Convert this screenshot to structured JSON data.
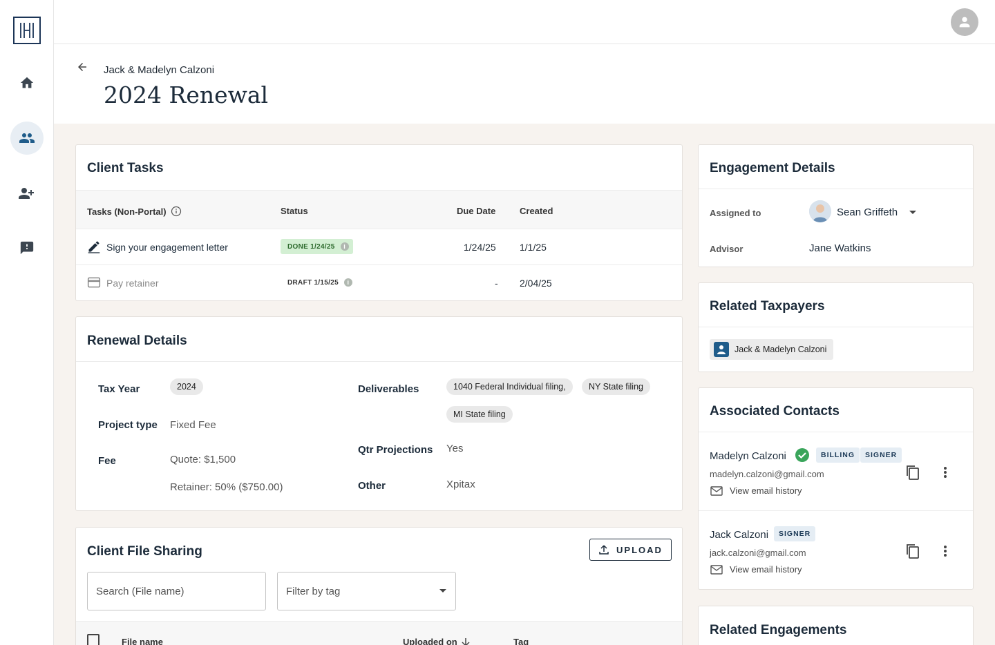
{
  "sidebar": {
    "logo_text": "H",
    "items": [
      {
        "icon": "home-icon"
      },
      {
        "icon": "people-icon",
        "active": true
      },
      {
        "icon": "person-add-icon"
      },
      {
        "icon": "feedback-icon"
      }
    ]
  },
  "header": {
    "breadcrumb": "Jack & Madelyn Calzoni",
    "title": "2024 Renewal"
  },
  "client_tasks": {
    "title": "Client Tasks",
    "columns": [
      "Tasks (Non-Portal)",
      "Status",
      "Due Date",
      "Created"
    ],
    "rows": [
      {
        "task": "Sign your engagement letter",
        "status": "DONE 1/24/25",
        "due": "1/24/25",
        "created": "1/1/25"
      },
      {
        "task": "Pay retainer",
        "status": "DRAFT 1/15/25",
        "due": "-",
        "created": "2/04/25"
      }
    ]
  },
  "renewal": {
    "title": "Renewal Details",
    "tax_year_label": "Tax Year",
    "tax_year": "2024",
    "project_type_label": "Project type",
    "project_type": "Fixed Fee",
    "fee_label": "Fee",
    "fee_quote": "Quote: $1,500",
    "fee_retainer": "Retainer: 50% ($750.00)",
    "deliverables_label": "Deliverables",
    "deliverables": [
      "1040 Federal Individual filing,",
      "NY State filing",
      "MI State filing"
    ],
    "qtr_label": "Qtr Projections",
    "qtr": "Yes",
    "other_label": "Other",
    "other": "Xpitax"
  },
  "file_sharing": {
    "title": "Client File Sharing",
    "upload_label": "UPLOAD",
    "search_placeholder": "Search (File name)",
    "filter_placeholder": "Filter by tag",
    "columns": [
      "File name",
      "Uploaded on",
      "Tag"
    ]
  },
  "engagement": {
    "title": "Engagement Details",
    "assigned_label": "Assigned to",
    "assigned": "Sean Griffeth",
    "advisor_label": "Advisor",
    "advisor": "Jane Watkins"
  },
  "related_taxpayers": {
    "title": "Related Taxpayers",
    "items": [
      "Jack & Madelyn Calzoni"
    ]
  },
  "associated_contacts": {
    "title": "Associated Contacts",
    "contacts": [
      {
        "name": "Madelyn Calzoni",
        "tags": [
          "BILLING",
          "SIGNER"
        ],
        "email": "madelyn.calzoni@gmail.com",
        "history": "View email history",
        "verified": true
      },
      {
        "name": "Jack Calzoni",
        "tags": [
          "SIGNER"
        ],
        "email": "jack.calzoni@gmail.com",
        "history": "View email history",
        "verified": false
      }
    ]
  },
  "related_engagements": {
    "title": "Related Engagements"
  },
  "colors": {
    "navy": "#1c2b3a",
    "accent_blue": "#1f5c8a",
    "done_green": "#d3efd3",
    "page_bg": "#f7f3ef"
  }
}
